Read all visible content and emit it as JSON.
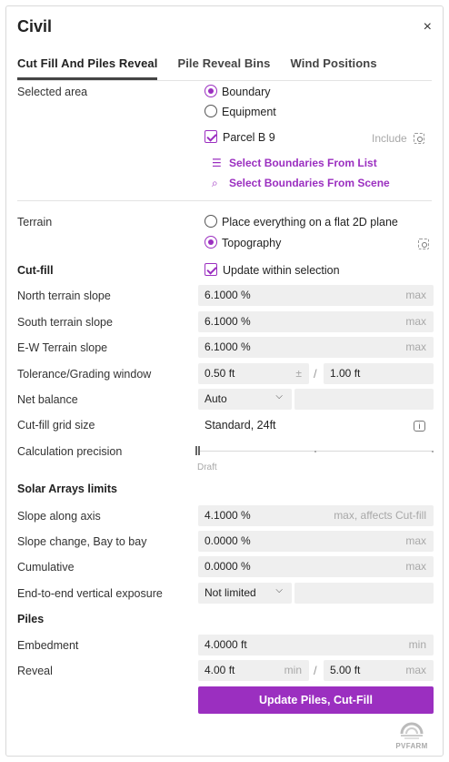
{
  "header": {
    "title": "Civil",
    "close": "×"
  },
  "tabs": [
    "Cut Fill And Piles Reveal",
    "Pile Reveal Bins",
    "Wind Positions"
  ],
  "selected_area": {
    "label": "Selected area",
    "options": [
      "Boundary",
      "Equipment"
    ],
    "selected": "Boundary",
    "parcel": "Parcel B 9",
    "include": "Include",
    "link_list": "Select Boundaries From List",
    "link_scene": "Select Boundaries From Scene"
  },
  "terrain": {
    "label": "Terrain",
    "options": [
      "Place everything on a flat 2D plane",
      "Topography"
    ],
    "selected": "Topography"
  },
  "cutfill": {
    "label": "Cut-fill",
    "update_within": "Update within selection",
    "north_label": "North terrain slope",
    "north_value": "6.1000 %",
    "north_unit": "max",
    "south_label": "South terrain slope",
    "south_value": "6.1000 %",
    "south_unit": "max",
    "ew_label": "E-W Terrain slope",
    "ew_value": "6.1000 %",
    "ew_unit": "max",
    "tol_label": "Tolerance/Grading window",
    "tol_a": "0.50 ft",
    "tol_pm": "±",
    "tol_sep": "/",
    "tol_b": "1.00 ft",
    "net_label": "Net balance",
    "net_value": "Auto",
    "grid_label": "Cut-fill grid size",
    "grid_value": "Standard, 24ft",
    "precision_label": "Calculation precision",
    "precision_caption": "Draft",
    "precision_level": 0
  },
  "solar": {
    "label": "Solar Arrays limits",
    "axis_label": "Slope along axis",
    "axis_value": "4.1000 %",
    "axis_unit": "max, affects Cut-fill",
    "bay_label": "Slope change, Bay to bay",
    "bay_value": "0.0000 %",
    "bay_unit": "max",
    "cum_label": "Cumulative",
    "cum_value": "0.0000 %",
    "cum_unit": "max",
    "exp_label": "End-to-end vertical exposure",
    "exp_value": "Not limited"
  },
  "piles": {
    "label": "Piles",
    "emb_label": "Embedment",
    "emb_value": "4.0000 ft",
    "emb_unit": "min",
    "rev_label": "Reveal",
    "rev_min": "4.00 ft",
    "rev_min_unit": "min",
    "rev_sep": "/",
    "rev_max": "5.00 ft",
    "rev_max_unit": "max"
  },
  "button": "Update Piles, Cut-Fill",
  "logo": "PVFARM",
  "colors": {
    "accent": "#9b2fc0",
    "field_bg": "#efefef",
    "muted": "#a8a8a8"
  }
}
